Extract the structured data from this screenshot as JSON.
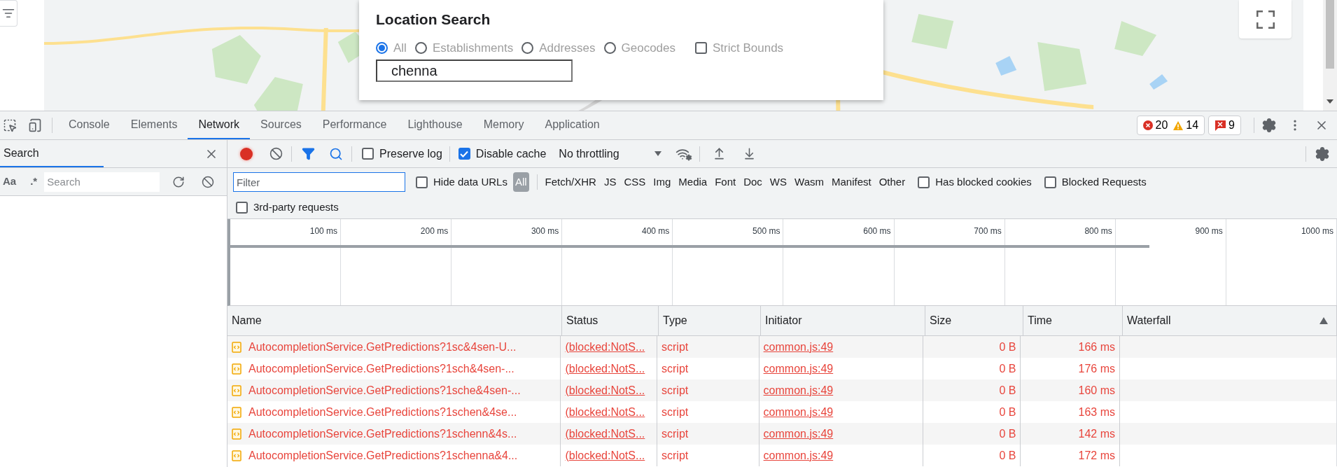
{
  "location_search": {
    "title": "Location Search",
    "options": [
      {
        "label": "All",
        "selected": true
      },
      {
        "label": "Establishments",
        "selected": false
      },
      {
        "label": "Addresses",
        "selected": false
      },
      {
        "label": "Geocodes",
        "selected": false
      }
    ],
    "strict_bounds": {
      "label": "Strict Bounds",
      "checked": false
    },
    "input": {
      "value": "chenna"
    }
  },
  "devtools": {
    "tabs": [
      {
        "label": "Console",
        "selected": false
      },
      {
        "label": "Elements",
        "selected": false
      },
      {
        "label": "Network",
        "selected": true
      },
      {
        "label": "Sources",
        "selected": false
      },
      {
        "label": "Performance",
        "selected": false
      },
      {
        "label": "Lighthouse",
        "selected": false
      },
      {
        "label": "Memory",
        "selected": false
      },
      {
        "label": "Application",
        "selected": false
      }
    ],
    "errors": "20",
    "warnings": "14",
    "issues": "9"
  },
  "search_panel": {
    "title": "Search",
    "match_case": "Aa",
    "regex": ".*",
    "search": {
      "placeholder": "Search"
    }
  },
  "toolbar": {
    "recording": true,
    "preserve_log": {
      "label": "Preserve log",
      "checked": false
    },
    "disable_cache": {
      "label": "Disable cache",
      "checked": true
    },
    "throttling": "No throttling"
  },
  "filter": {
    "placeholder": "Filter",
    "hide_data_urls": {
      "label": "Hide data URLs",
      "checked": false
    },
    "types": [
      {
        "label": "All",
        "selected": true
      },
      {
        "label": "Fetch/XHR",
        "selected": false
      },
      {
        "label": "JS",
        "selected": false
      },
      {
        "label": "CSS",
        "selected": false
      },
      {
        "label": "Img",
        "selected": false
      },
      {
        "label": "Media",
        "selected": false
      },
      {
        "label": "Font",
        "selected": false
      },
      {
        "label": "Doc",
        "selected": false
      },
      {
        "label": "WS",
        "selected": false
      },
      {
        "label": "Wasm",
        "selected": false
      },
      {
        "label": "Manifest",
        "selected": false
      },
      {
        "label": "Other",
        "selected": false
      }
    ],
    "has_blocked_cookies": {
      "label": "Has blocked cookies",
      "checked": false
    },
    "blocked_requests": {
      "label": "Blocked Requests",
      "checked": false
    },
    "third_party": {
      "label": "3rd-party requests",
      "checked": false
    }
  },
  "overview": {
    "ticks": [
      "100 ms",
      "200 ms",
      "300 ms",
      "400 ms",
      "500 ms",
      "600 ms",
      "700 ms",
      "800 ms",
      "900 ms",
      "1000 ms"
    ]
  },
  "table": {
    "columns": [
      "Name",
      "Status",
      "Type",
      "Initiator",
      "Size",
      "Time",
      "Waterfall"
    ],
    "rows": [
      {
        "name": "AutocompletionService.GetPredictions?1sc&4sen-U...",
        "status": "(blocked:NotS...",
        "type": "script",
        "initiator": "common.js:49",
        "size": "0 B",
        "time": "166 ms",
        "blocked": true
      },
      {
        "name": "AutocompletionService.GetPredictions?1sch&4sen-...",
        "status": "(blocked:NotS...",
        "type": "script",
        "initiator": "common.js:49",
        "size": "0 B",
        "time": "176 ms",
        "blocked": true
      },
      {
        "name": "AutocompletionService.GetPredictions?1sche&4sen-...",
        "status": "(blocked:NotS...",
        "type": "script",
        "initiator": "common.js:49",
        "size": "0 B",
        "time": "160 ms",
        "blocked": true
      },
      {
        "name": "AutocompletionService.GetPredictions?1schen&4se...",
        "status": "(blocked:NotS...",
        "type": "script",
        "initiator": "common.js:49",
        "size": "0 B",
        "time": "163 ms",
        "blocked": true
      },
      {
        "name": "AutocompletionService.GetPredictions?1schenn&4s...",
        "status": "(blocked:NotS...",
        "type": "script",
        "initiator": "common.js:49",
        "size": "0 B",
        "time": "142 ms",
        "blocked": true
      },
      {
        "name": "AutocompletionService.GetPredictions?1schenna&4...",
        "status": "(blocked:NotS...",
        "type": "script",
        "initiator": "common.js:49",
        "size": "0 B",
        "time": "172 ms",
        "blocked": true
      }
    ]
  }
}
